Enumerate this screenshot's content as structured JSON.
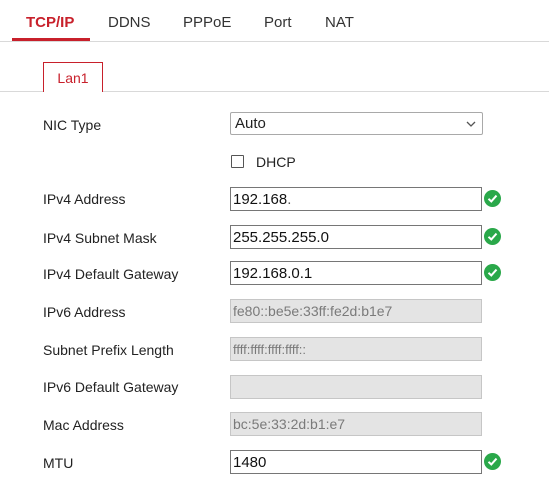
{
  "tabs": [
    {
      "label": "TCP/IP",
      "active": true
    },
    {
      "label": "DDNS",
      "active": false
    },
    {
      "label": "PPPoE",
      "active": false
    },
    {
      "label": "Port",
      "active": false
    },
    {
      "label": "NAT",
      "active": false
    }
  ],
  "subtab": {
    "label": "Lan1"
  },
  "colors": {
    "accent": "#c8202b",
    "ok": "#2aa84a",
    "disabled_bg": "#e4e4e4"
  },
  "form": {
    "nic_type": {
      "label": "NIC Type",
      "value": "Auto"
    },
    "dhcp": {
      "label": "DHCP",
      "checked": false
    },
    "ipv4_address": {
      "label": "IPv4 Address",
      "value": "192.168.",
      "status_icon": "check-circle-icon"
    },
    "ipv4_subnet_mask": {
      "label": "IPv4 Subnet Mask",
      "value": "255.255.255.0",
      "status_icon": "check-circle-icon"
    },
    "ipv4_default_gateway": {
      "label": "IPv4 Default Gateway",
      "value": "192.168.0.1",
      "status_icon": "check-circle-icon"
    },
    "ipv6_address": {
      "label": "IPv6 Address",
      "value": "fe80::be5e:33ff:fe2d:b1e7"
    },
    "subnet_prefix_length": {
      "label": "Subnet Prefix Length",
      "value": "ffff:ffff:ffff:ffff::"
    },
    "ipv6_default_gateway": {
      "label": "IPv6 Default Gateway",
      "value": ""
    },
    "mac_address": {
      "label": "Mac Address",
      "value": "bc:5e:33:2d:b1:e7"
    },
    "mtu": {
      "label": "MTU",
      "value": "1480",
      "status_icon": "check-circle-icon"
    }
  }
}
